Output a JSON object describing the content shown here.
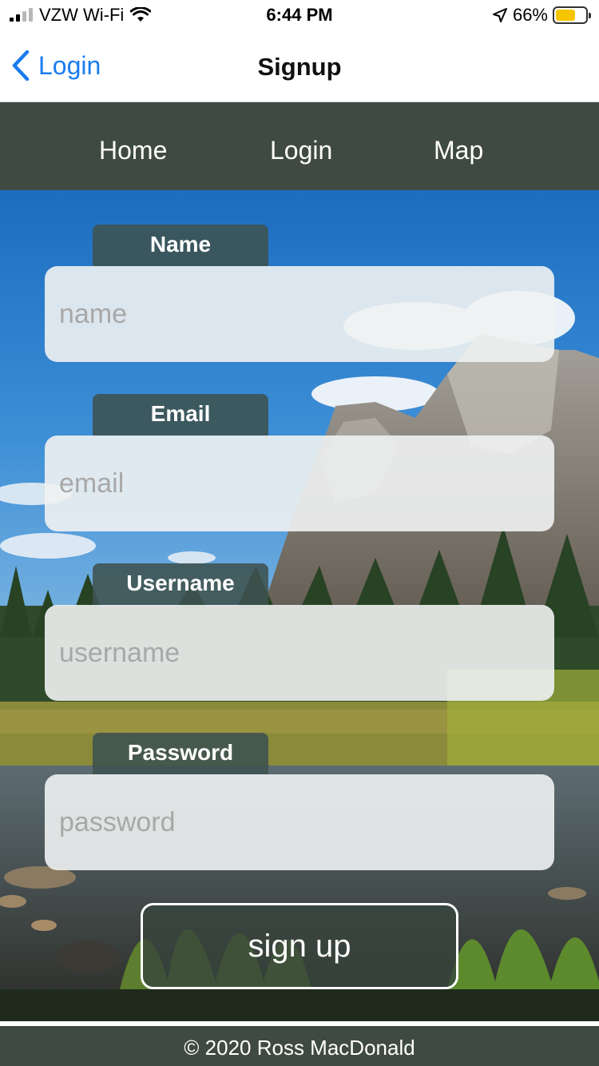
{
  "status_bar": {
    "carrier": "VZW Wi-Fi",
    "time": "6:44 PM",
    "battery_percent": "66%",
    "battery_level": 0.66,
    "icons": [
      "signal-icon",
      "wifi-icon",
      "location-arrow-icon",
      "battery-icon"
    ]
  },
  "nav": {
    "back_label": "Login",
    "title": "Signup"
  },
  "menu": {
    "home": "Home",
    "login": "Login",
    "map": "Map"
  },
  "form": {
    "name_label": "Name",
    "name_placeholder": "name",
    "email_label": "Email",
    "email_placeholder": "email",
    "username_label": "Username",
    "username_placeholder": "username",
    "password_label": "Password",
    "password_placeholder": "password",
    "submit_label": "sign up"
  },
  "footer": {
    "copyright": "© 2020 Ross MacDonald"
  },
  "colors": {
    "menu_bg": "#3f4a42",
    "link_blue": "#1a7cf0",
    "label_bg": "#3e5250"
  }
}
